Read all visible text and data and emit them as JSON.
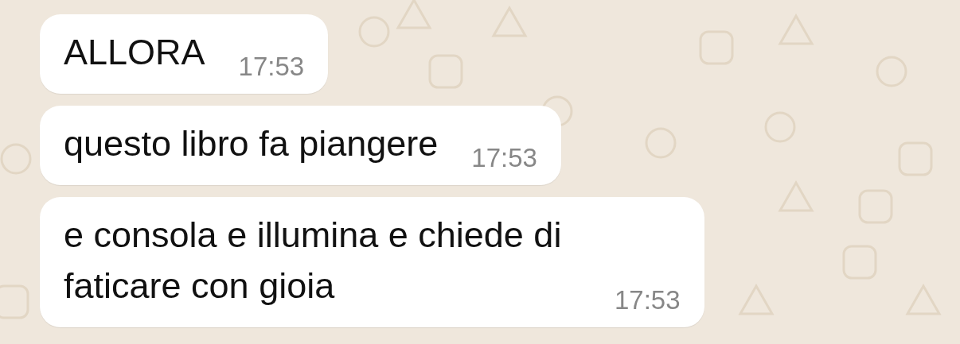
{
  "messages": [
    {
      "text": "ALLORA",
      "time": "17:53"
    },
    {
      "text": "questo libro fa piangere",
      "time": "17:53"
    },
    {
      "text": "e consola e illumina e chiede di faticare con gioia",
      "time": "17:53"
    }
  ]
}
